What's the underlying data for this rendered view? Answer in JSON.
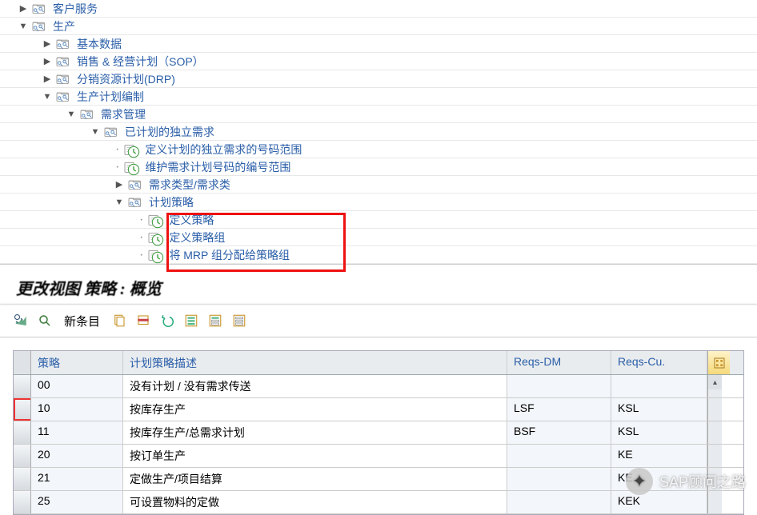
{
  "tree": [
    {
      "level": 0,
      "toggle": "▶",
      "type": "folder",
      "label": "客户服务"
    },
    {
      "level": 0,
      "toggle": "▼",
      "type": "folder",
      "label": "生产"
    },
    {
      "level": 1,
      "toggle": "▶",
      "type": "folder",
      "label": "基本数据"
    },
    {
      "level": 1,
      "toggle": "▶",
      "type": "folder",
      "label": "销售 & 经营计划（SOP）"
    },
    {
      "level": 1,
      "toggle": "▶",
      "type": "folder",
      "label": "分销资源计划(DRP)"
    },
    {
      "level": 1,
      "toggle": "▼",
      "type": "folder",
      "label": "生产计划编制"
    },
    {
      "level": 2,
      "toggle": "▼",
      "type": "folder",
      "label": "需求管理"
    },
    {
      "level": 3,
      "toggle": "▼",
      "type": "folder",
      "label": "已计划的独立需求"
    },
    {
      "level": 4,
      "toggle": "·",
      "type": "exec",
      "label": "定义计划的独立需求的号码范围"
    },
    {
      "level": 4,
      "toggle": "·",
      "type": "exec",
      "label": "维护需求计划号码的编号范围"
    },
    {
      "level": 4,
      "toggle": "▶",
      "type": "folder",
      "label": "需求类型/需求类"
    },
    {
      "level": 4,
      "toggle": "▼",
      "type": "folder",
      "label": "计划策略"
    },
    {
      "level": 5,
      "toggle": "·",
      "type": "exec",
      "label": "定义策略"
    },
    {
      "level": 5,
      "toggle": "·",
      "type": "exec",
      "label": "定义策略组"
    },
    {
      "level": 5,
      "toggle": "·",
      "type": "exec",
      "label": "将 MRP 组分配给策略组"
    }
  ],
  "view_title": "更改视图  策略 :  概览",
  "toolbar": {
    "new_entry": "新条目"
  },
  "table": {
    "headers": {
      "code": "策略",
      "desc": "计划策略描述",
      "dm": "Reqs-DM",
      "cu": "Reqs-Cu."
    },
    "rows": [
      {
        "code": "00",
        "desc": "没有计划 / 没有需求传送",
        "dm": "",
        "cu": ""
      },
      {
        "code": "10",
        "desc": "按库存生产",
        "dm": "LSF",
        "cu": "KSL",
        "changed": true
      },
      {
        "code": "11",
        "desc": "按库存生产/总需求计划",
        "dm": "BSF",
        "cu": "KSL"
      },
      {
        "code": "20",
        "desc": "按订单生产",
        "dm": "",
        "cu": "KE"
      },
      {
        "code": "21",
        "desc": "定做生产/项目结算",
        "dm": "",
        "cu": "KE"
      },
      {
        "code": "25",
        "desc": "可设置物料的定做",
        "dm": "",
        "cu": "KEK"
      }
    ]
  },
  "watermark": "SAP顾问之路"
}
